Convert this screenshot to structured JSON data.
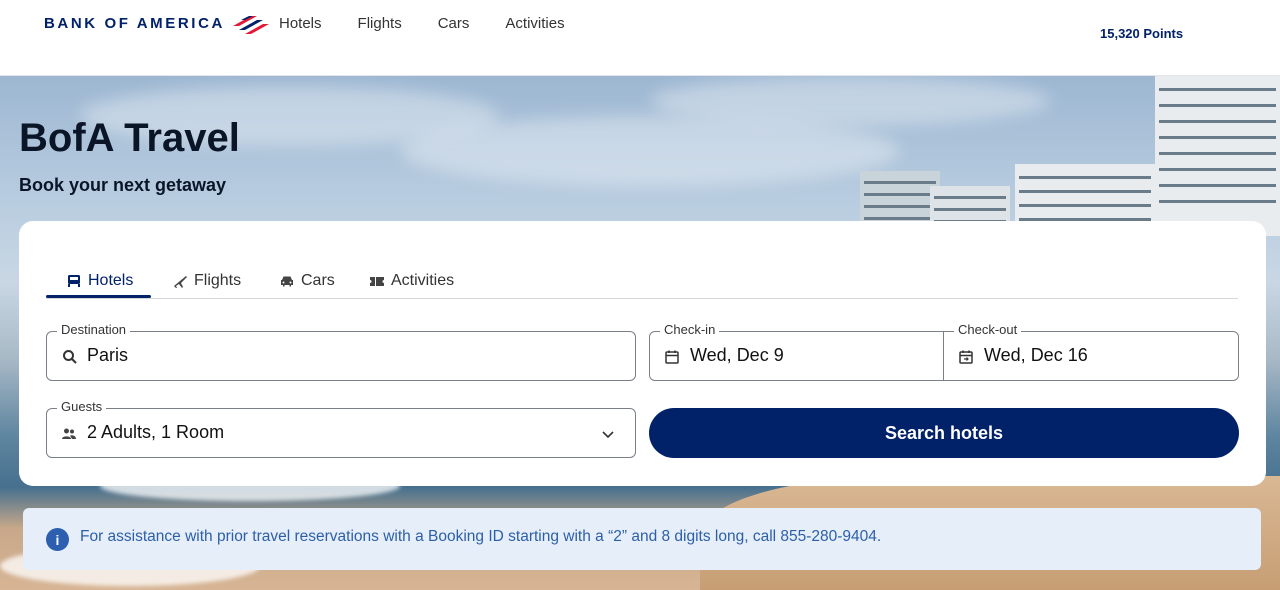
{
  "header": {
    "logo_text": "BANK OF AMERICA",
    "nav": [
      "Hotels",
      "Flights",
      "Cars",
      "Activities"
    ],
    "points": "15,320 Points"
  },
  "hero": {
    "title": "BofA Travel",
    "subtitle": "Book your next getaway"
  },
  "search": {
    "tabs": [
      {
        "label": "Hotels",
        "icon": "bed-icon",
        "active": true
      },
      {
        "label": "Flights",
        "icon": "plane-icon",
        "active": false
      },
      {
        "label": "Cars",
        "icon": "car-icon",
        "active": false
      },
      {
        "label": "Activities",
        "icon": "ticket-icon",
        "active": false
      }
    ],
    "destination": {
      "label": "Destination",
      "value": "Paris"
    },
    "checkin": {
      "label": "Check-in",
      "value": "Wed, Dec 9"
    },
    "checkout": {
      "label": "Check-out",
      "value": "Wed, Dec 16"
    },
    "guests": {
      "label": "Guests",
      "value": "2 Adults, 1 Room"
    },
    "button": "Search hotels"
  },
  "info": {
    "icon_label": "i",
    "text": "For assistance with prior travel reservations with a Booking ID starting with a “2” and 8 digits long, call 855-280-9404."
  },
  "colors": {
    "brand_navy": "#012169",
    "brand_red": "#e31837",
    "info_bg": "#e5eef9",
    "info_text": "#2d5fa8"
  }
}
